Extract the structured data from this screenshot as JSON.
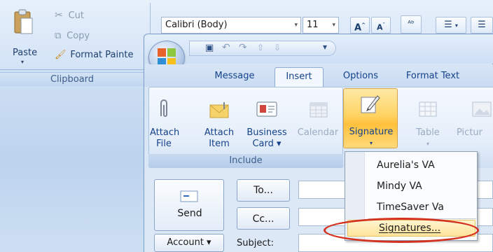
{
  "clipboard": {
    "paste_label": "Paste",
    "cut_label": "Cut",
    "copy_label": "Copy",
    "format_painter_label": "Format Painte",
    "group_label": "Clipboard"
  },
  "font": {
    "family": "Calibri (Body)",
    "size": "11"
  },
  "message_window": {
    "tabs": [
      {
        "label": "Message"
      },
      {
        "label": "Insert"
      },
      {
        "label": "Options"
      },
      {
        "label": "Format Text"
      }
    ],
    "active_tab": "Insert",
    "include_group": {
      "label": "Include",
      "buttons": [
        {
          "label_line1": "Attach",
          "label_line2": "File"
        },
        {
          "label_line1": "Attach",
          "label_line2": "Item"
        },
        {
          "label_line1": "Business",
          "label_line2": "Card ▾"
        },
        {
          "label_line1": "Calendar",
          "label_line2": ""
        }
      ]
    },
    "signature_label": "Signature",
    "table_label": "Table",
    "picture_label": "Pictur",
    "send_label": "Send",
    "to_label": "To...",
    "cc_label": "Cc...",
    "account_label": "Account ▾",
    "subject_label": "Subject:"
  },
  "signature_menu": {
    "items": [
      "Aurelia's VA",
      "Mindy VA",
      "TimeSaver Va"
    ],
    "manage_label": "Signatures..."
  },
  "colors": {
    "highlight": "#ffd363",
    "circle": "#d4311f"
  }
}
